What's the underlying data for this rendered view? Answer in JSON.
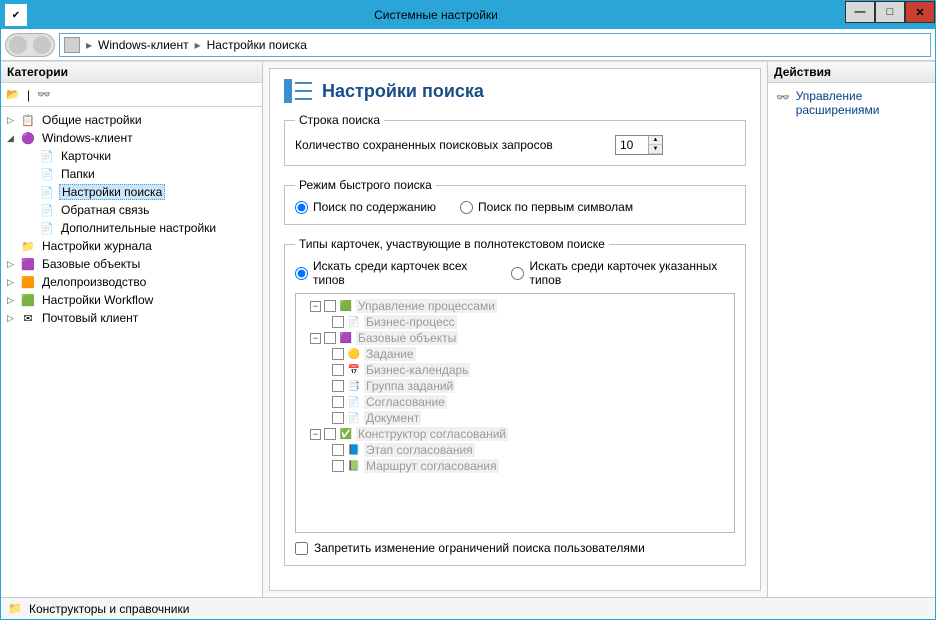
{
  "window": {
    "title": "Системные настройки"
  },
  "breadcrumb": {
    "a": "Windows-клиент",
    "b": "Настройки поиска"
  },
  "sidebar": {
    "header": "Категории",
    "nodes": {
      "general": "Общие настройки",
      "winclient": "Windows-клиент",
      "cards": "Карточки",
      "folders": "Папки",
      "search": "Настройки поиска",
      "feedback": "Обратная связь",
      "extra": "Дополнительные настройки",
      "journal": "Настройки журнала",
      "baseobj": "Базовые объекты",
      "doflow": "Делопроизводство",
      "workflow": "Настройки Workflow",
      "mail": "Почтовый клиент"
    }
  },
  "page": {
    "title": "Настройки поиска",
    "group1": {
      "legend": "Строка поиска",
      "label": "Количество сохраненных поисковых запросов",
      "value": "10"
    },
    "group2": {
      "legend": "Режим быстрого поиска",
      "opt1": "Поиск по содержанию",
      "opt2": "Поиск по первым символам"
    },
    "group3": {
      "legend": "Типы карточек, участвующие в полнотекстовом поиске",
      "opt1": "Искать среди карточек всех типов",
      "opt2": "Искать среди карточек указанных типов",
      "tree": {
        "n1": "Управление процессами",
        "n1a": "Бизнес-процесс",
        "n2": "Базовые объекты",
        "n2a": "Задание",
        "n2b": "Бизнес-календарь",
        "n2c": "Группа заданий",
        "n2d": "Согласование",
        "n2e": "Документ",
        "n3": "Конструктор согласований",
        "n3a": "Этап согласования",
        "n3b": "Маршрут согласования"
      },
      "lockLabel": "Запретить изменение ограничений поиска пользователями"
    }
  },
  "actions": {
    "header": "Действия",
    "link": "Управление расширениями"
  },
  "status": {
    "text": "Конструкторы и справочники"
  }
}
